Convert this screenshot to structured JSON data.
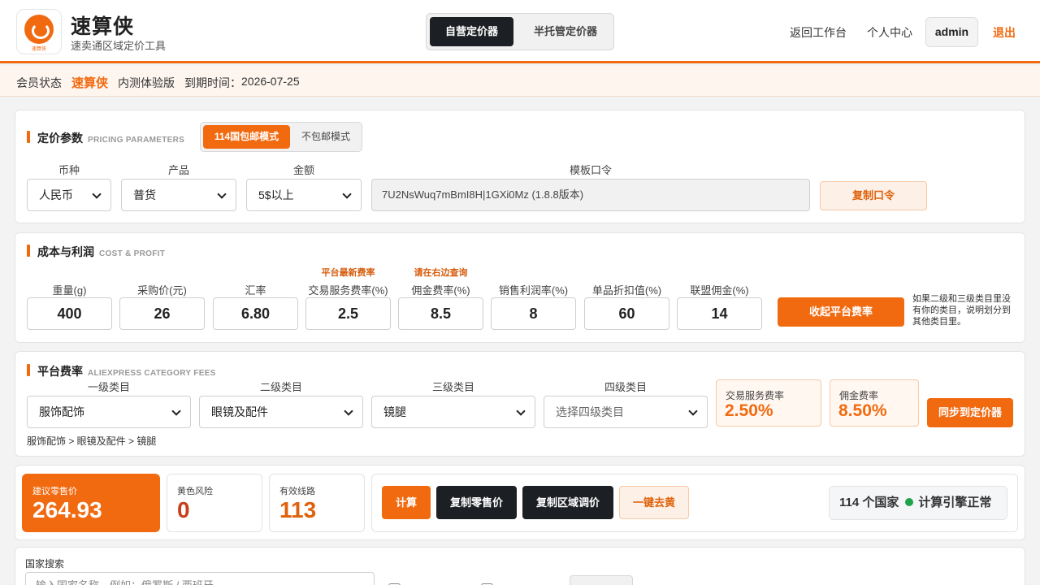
{
  "header": {
    "app_title": "速算侠",
    "app_subtitle": "速卖通区域定价工具",
    "logo_text": "速算侠",
    "mode_tabs": [
      "自营定价器",
      "半托管定价器"
    ],
    "nav": {
      "workbench": "返回工作台",
      "profile": "个人中心",
      "user": "admin",
      "logout": "退出"
    }
  },
  "member": {
    "status_label": "会员状态",
    "brand": "速算侠",
    "plan": "内测体验版",
    "expire_label": "到期时间：",
    "expire_date": "2026-07-25"
  },
  "pricing": {
    "title": "定价参数",
    "title_en": "PRICING PARAMETERS",
    "modes": [
      "114国包邮模式",
      "不包邮模式"
    ],
    "currency": {
      "label": "币种",
      "value": "人民币"
    },
    "product": {
      "label": "产品",
      "value": "普货"
    },
    "amount": {
      "label": "金额",
      "value": "5$以上"
    },
    "template": {
      "label": "模板口令",
      "value": "7U2NsWuq7mBmI8H|1GXi0Mz (1.8.8版本)"
    },
    "copy_button": "复制口令"
  },
  "cost": {
    "title": "成本与利润",
    "title_en": "COST & PROFIT",
    "hints": {
      "service_fee": "平台最新费率",
      "commission": "请在右边查询"
    },
    "fields": [
      {
        "label": "重量(g)",
        "value": "400"
      },
      {
        "label": "采购价(元)",
        "value": "26"
      },
      {
        "label": "汇率",
        "value": "6.80"
      },
      {
        "label": "交易服务费率(%)",
        "value": "2.5"
      },
      {
        "label": "佣金费率(%)",
        "value": "8.5"
      },
      {
        "label": "销售利润率(%)",
        "value": "8"
      },
      {
        "label": "单品折扣值(%)",
        "value": "60"
      },
      {
        "label": "联盟佣金(%)",
        "value": "14"
      }
    ],
    "collapse_button": "收起平台费率",
    "note": "如果二级和三级类目里没有你的类目，说明划分到其他类目里。"
  },
  "platform": {
    "title": "平台费率",
    "title_en": "ALIEXPRESS CATEGORY FEES",
    "levels": [
      {
        "label": "一级类目",
        "value": "服饰配饰"
      },
      {
        "label": "二级类目",
        "value": "眼镜及配件"
      },
      {
        "label": "三级类目",
        "value": "镜腿"
      },
      {
        "label": "四级类目",
        "value": "选择四级类目"
      }
    ],
    "service_fee": {
      "label": "交易服务费率",
      "value": "2.50%"
    },
    "commission": {
      "label": "佣金费率",
      "value": "8.50%"
    },
    "sync_button": "同步到定价器",
    "breadcrumb": "服饰配饰 > 眼镜及配件 > 镜腿"
  },
  "results": {
    "suggested_price": {
      "label": "建议零售价",
      "value": "264.93"
    },
    "yellow_risk": {
      "label": "黄色风险",
      "value": "0"
    },
    "valid_routes": {
      "label": "有效线路",
      "value": "113"
    },
    "actions": [
      "计算",
      "复制零售价",
      "复制区域调价",
      "一键去黄"
    ],
    "country_count": "114 个国家",
    "engine_status": "计算引擎正常"
  },
  "search": {
    "label": "国家搜索",
    "placeholder": "输入国家名称，例如：俄罗斯 / 西班牙"
  },
  "colors": {
    "accent": "#f26a10",
    "dark": "#1c1f24",
    "ok": "#1fa34a"
  }
}
